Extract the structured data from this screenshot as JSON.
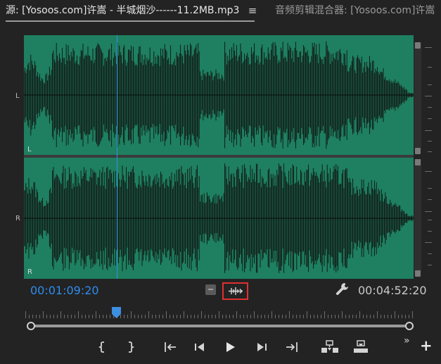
{
  "tabs": {
    "source_title": "源: [Yosoos.com]许嵩 - 半城烟沙------11.2MB.mp3",
    "menu_icon": "hamburger-menu-icon",
    "mixer_title": "音频剪辑混合器: [Yosoos.com]许嵩"
  },
  "waveform": {
    "channel_left_label": "L",
    "channel_right_label": "R",
    "side_left_label": "L",
    "side_right_label": "R",
    "wave_color": "#1e8060",
    "playhead_color": "#3d8fe0"
  },
  "controls": {
    "current_timecode": "00:01:09:20",
    "duration_timecode": "00:04:52:20",
    "timecode_color": "#2e8df0",
    "drag_audio_icon": "drag-audio-only-icon",
    "settings_icon": "wrench-icon"
  },
  "transport": {
    "buttons": [
      "mark-in-icon",
      "mark-out-icon",
      "go-to-in-icon",
      "step-back-icon",
      "play-icon",
      "step-forward-icon",
      "go-to-out-icon",
      "insert-icon",
      "overwrite-icon"
    ],
    "more_label": "»",
    "add_label": "+"
  }
}
